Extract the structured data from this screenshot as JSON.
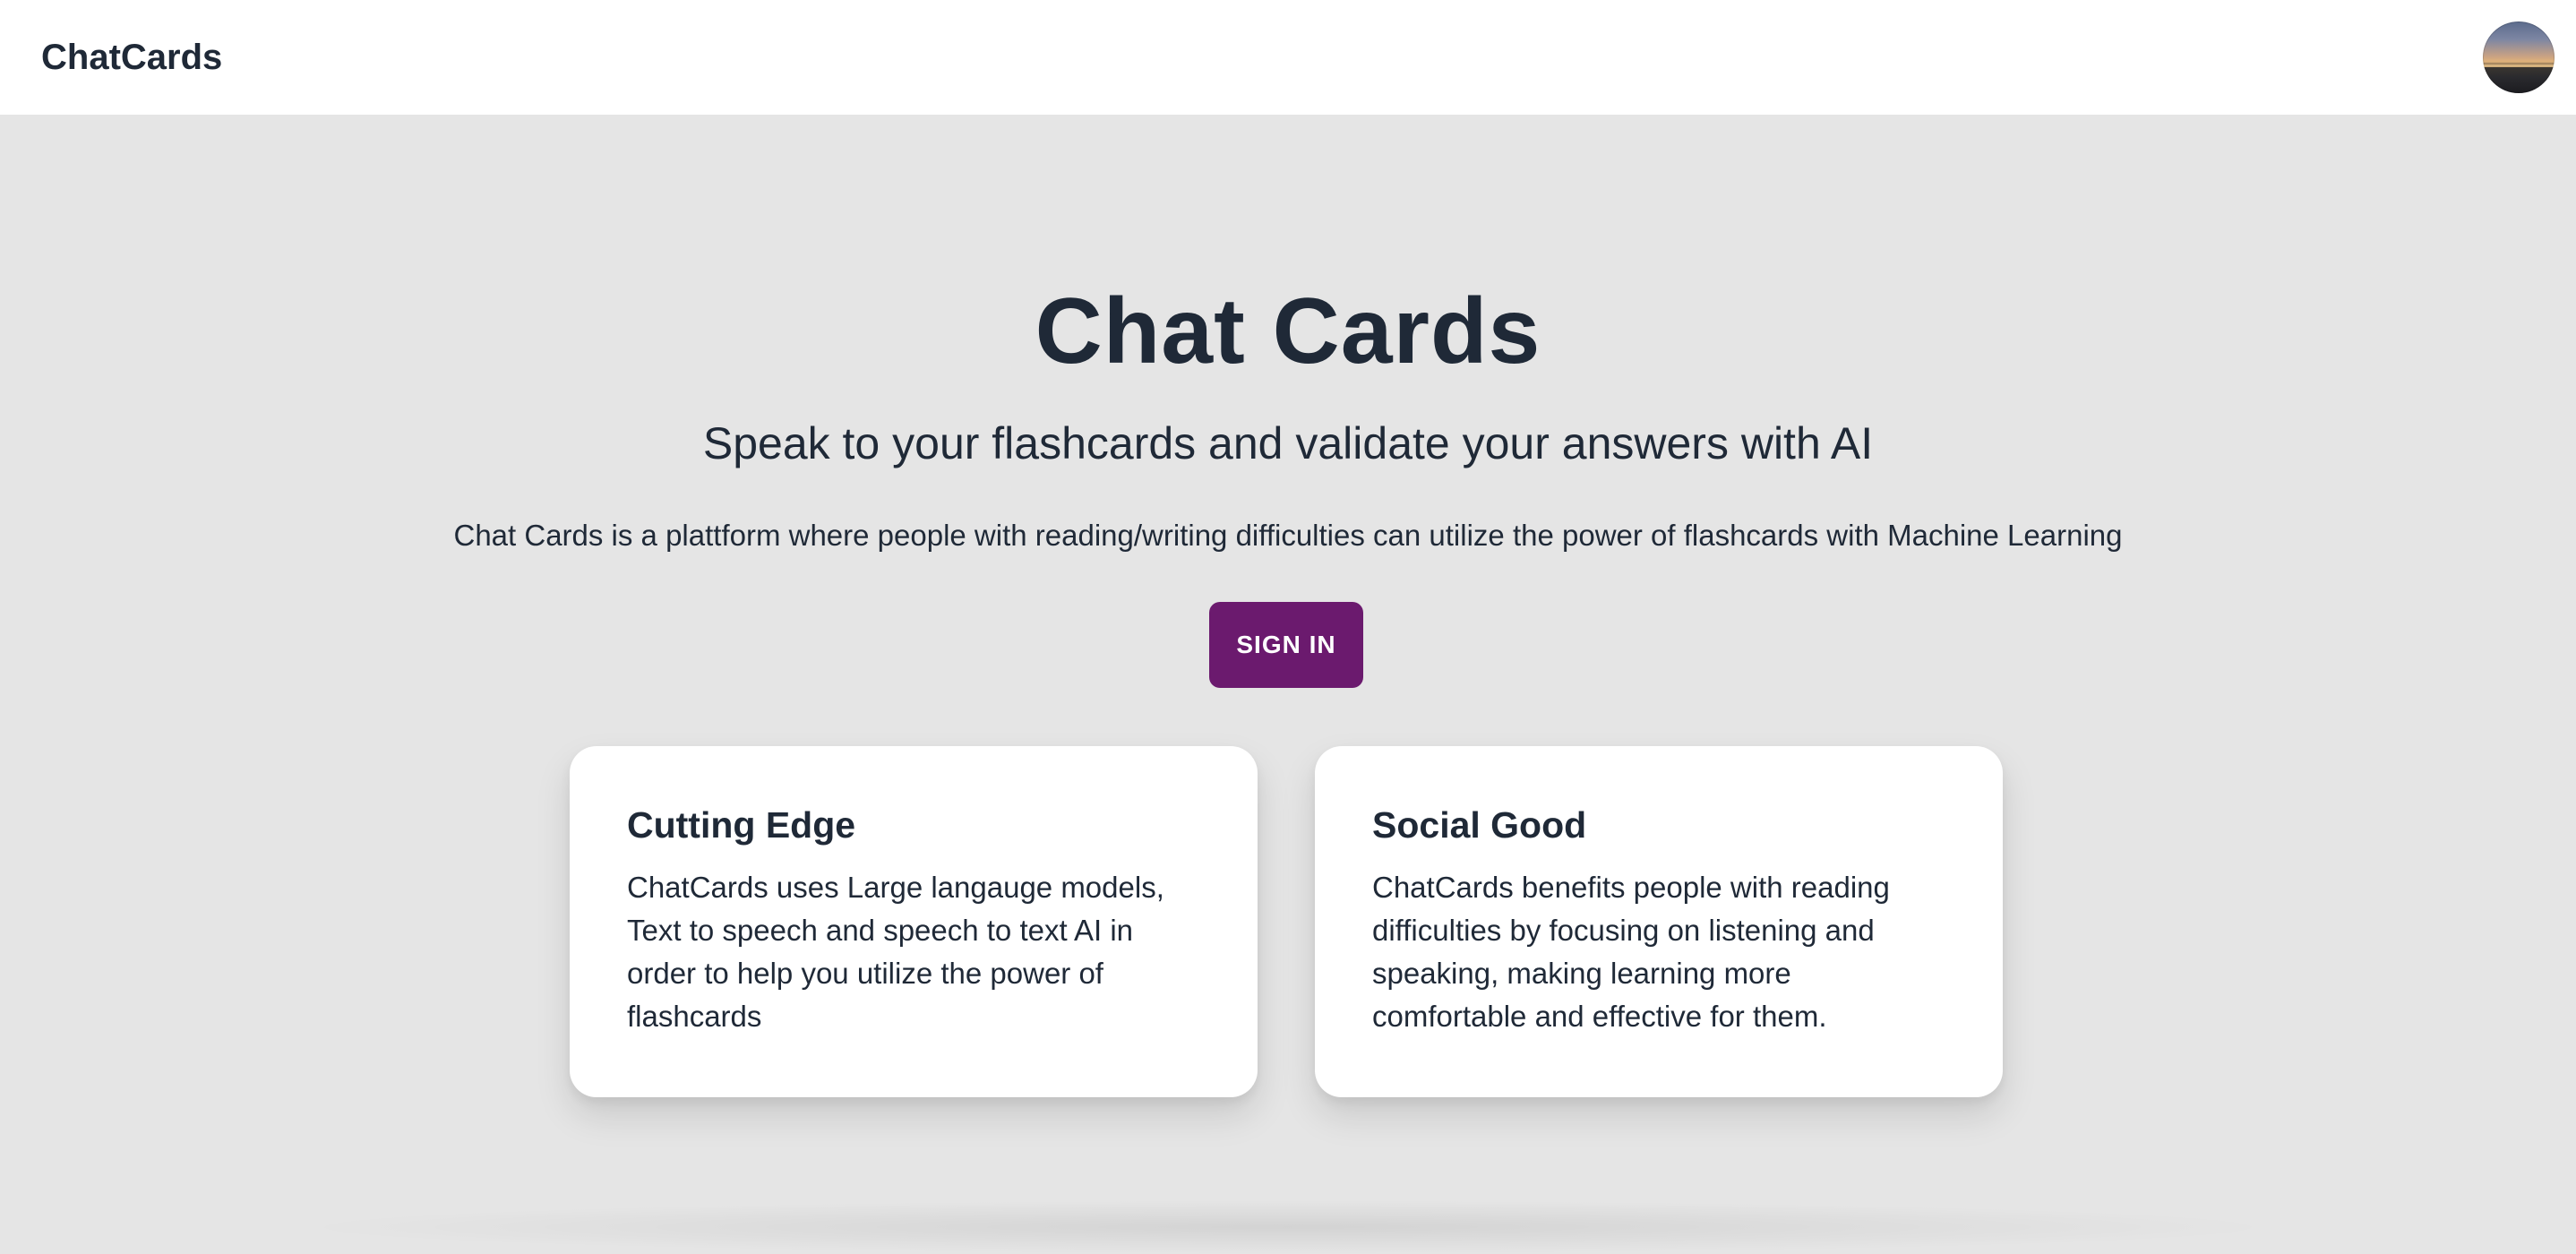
{
  "navbar": {
    "brand": "ChatCards",
    "avatar_icon": "user-avatar-photo"
  },
  "hero": {
    "title": "Chat Cards",
    "subtitle": "Speak to your flashcards and validate your answers with AI",
    "description": "Chat Cards is a plattform where people with reading/writing difficulties can utilize the power of flashcards with Machine Learning",
    "signin_label": "SIGN IN"
  },
  "cards": [
    {
      "title": "Cutting Edge",
      "body": "ChatCards uses Large langauge models, Text to speech and speech to text AI in order to help you utilize the power of flashcards"
    },
    {
      "title": "Social Good",
      "body": "ChatCards benefits people with reading difficulties by focusing on listening and speaking, making learning more comfortable and effective for them."
    }
  ],
  "colors": {
    "background": "#e5e5e5",
    "navbar": "#ffffff",
    "text": "#1f2937",
    "accent": "#6b1a6e"
  }
}
